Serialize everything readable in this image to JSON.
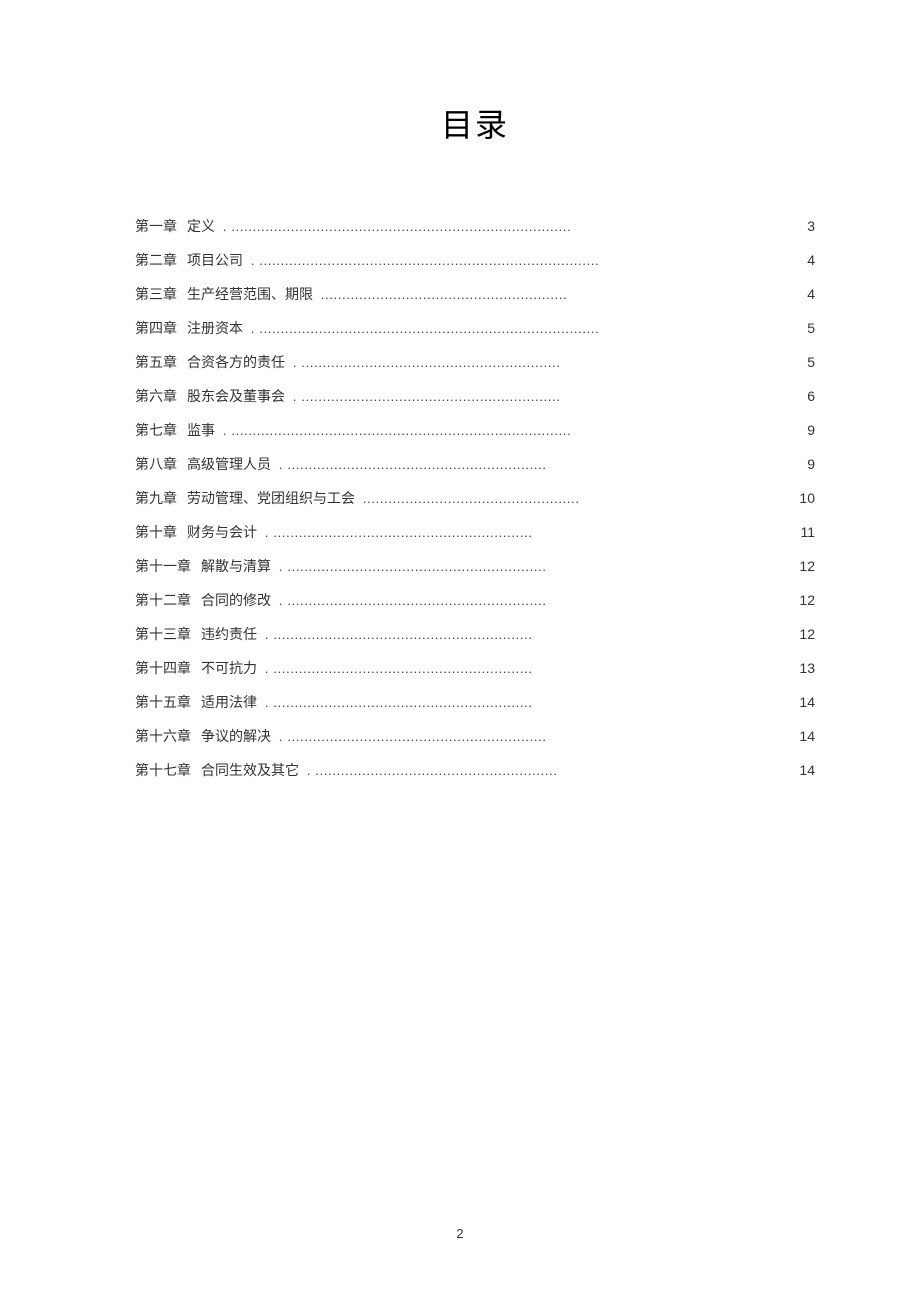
{
  "title": "目录",
  "toc": [
    {
      "chapter": "第一章",
      "name": "定义",
      "dots": ". ................................................................................",
      "page": "3"
    },
    {
      "chapter": "第二章",
      "name": "项目公司",
      "dots": ". ................................................................................",
      "page": "4"
    },
    {
      "chapter": "第三章",
      "name": "生产经营范围、期限",
      "dots": "..........................................................",
      "page": "4"
    },
    {
      "chapter": "第四章",
      "name": "注册资本",
      "dots": ". ................................................................................",
      "page": "5"
    },
    {
      "chapter": "第五章",
      "name": "合资各方的责任",
      "dots": ". .............................................................",
      "page": "5"
    },
    {
      "chapter": "第六章",
      "name": "股东会及董事会",
      "dots": ". .............................................................",
      "page": "6"
    },
    {
      "chapter": "第七章",
      "name": "监事",
      "dots": ". ................................................................................",
      "page": "9"
    },
    {
      "chapter": "第八章",
      "name": "高级管理人员",
      "dots": ". .............................................................",
      "page": "9"
    },
    {
      "chapter": "第九章",
      "name": "劳动管理、党团组织与工会",
      "dots": "...................................................",
      "page": "10"
    },
    {
      "chapter": "第十章",
      "name": "财务与会计",
      "dots": ". .............................................................",
      "page": "11"
    },
    {
      "chapter": "第十一章",
      "name": "解散与清算",
      "dots": ". .............................................................",
      "page": "12"
    },
    {
      "chapter": "第十二章",
      "name": "合同的修改",
      "dots": ". .............................................................",
      "page": "12"
    },
    {
      "chapter": "第十三章",
      "name": "违约责任",
      "dots": ". .............................................................",
      "page": "12"
    },
    {
      "chapter": "第十四章",
      "name": "不可抗力",
      "dots": ". .............................................................",
      "page": "13"
    },
    {
      "chapter": "第十五章",
      "name": "适用法律",
      "dots": ". .............................................................",
      "page": "14"
    },
    {
      "chapter": "第十六章",
      "name": "争议的解决",
      "dots": ". .............................................................",
      "page": "14"
    },
    {
      "chapter": "第十七章",
      "name": "合同生效及其它",
      "dots": ". .........................................................",
      "page": "14"
    }
  ],
  "current_page": "2"
}
